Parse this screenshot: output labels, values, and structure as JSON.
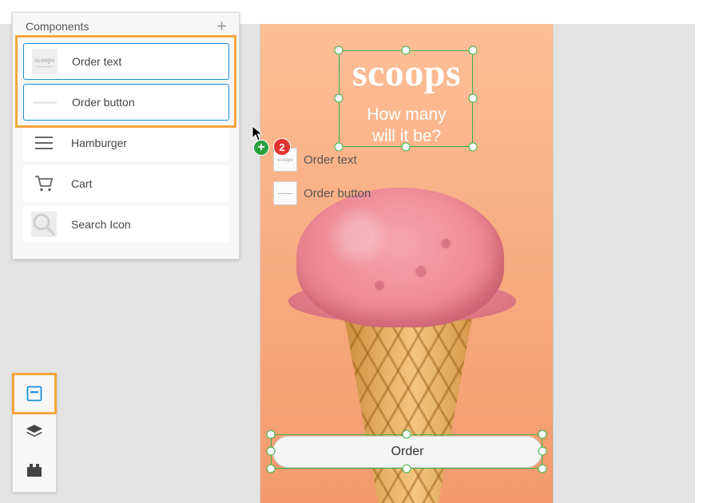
{
  "panel": {
    "title": "Components",
    "add_icon": "plus-icon",
    "items": [
      {
        "label": "Order text",
        "icon": "order-text-thumbnail",
        "selected": true
      },
      {
        "label": "Order button",
        "icon": "order-button-thumbnail",
        "selected": true
      },
      {
        "label": "Hamburger",
        "icon": "hamburger-icon",
        "selected": false
      },
      {
        "label": "Cart",
        "icon": "cart-icon",
        "selected": false
      },
      {
        "label": "Search Icon",
        "icon": "search-icon",
        "selected": false
      }
    ]
  },
  "artboard": {
    "brand": "scoops",
    "tagline_line1": "How many",
    "tagline_line2": "will it be?",
    "order_button_label": "Order"
  },
  "drag_preview": {
    "count_badge": "2",
    "items": [
      {
        "label": "Order text"
      },
      {
        "label": "Order button"
      }
    ]
  },
  "toolbar": {
    "tools": [
      {
        "icon": "components-icon",
        "active": true
      },
      {
        "icon": "layers-icon",
        "active": false
      },
      {
        "icon": "plugins-icon",
        "active": false
      }
    ]
  },
  "colors": {
    "selection_green": "#3cb34a",
    "highlight_orange": "#f5a53a",
    "selected_blue": "#1a8fd8",
    "badge_red": "#e33030",
    "badge_green": "#27a040"
  }
}
